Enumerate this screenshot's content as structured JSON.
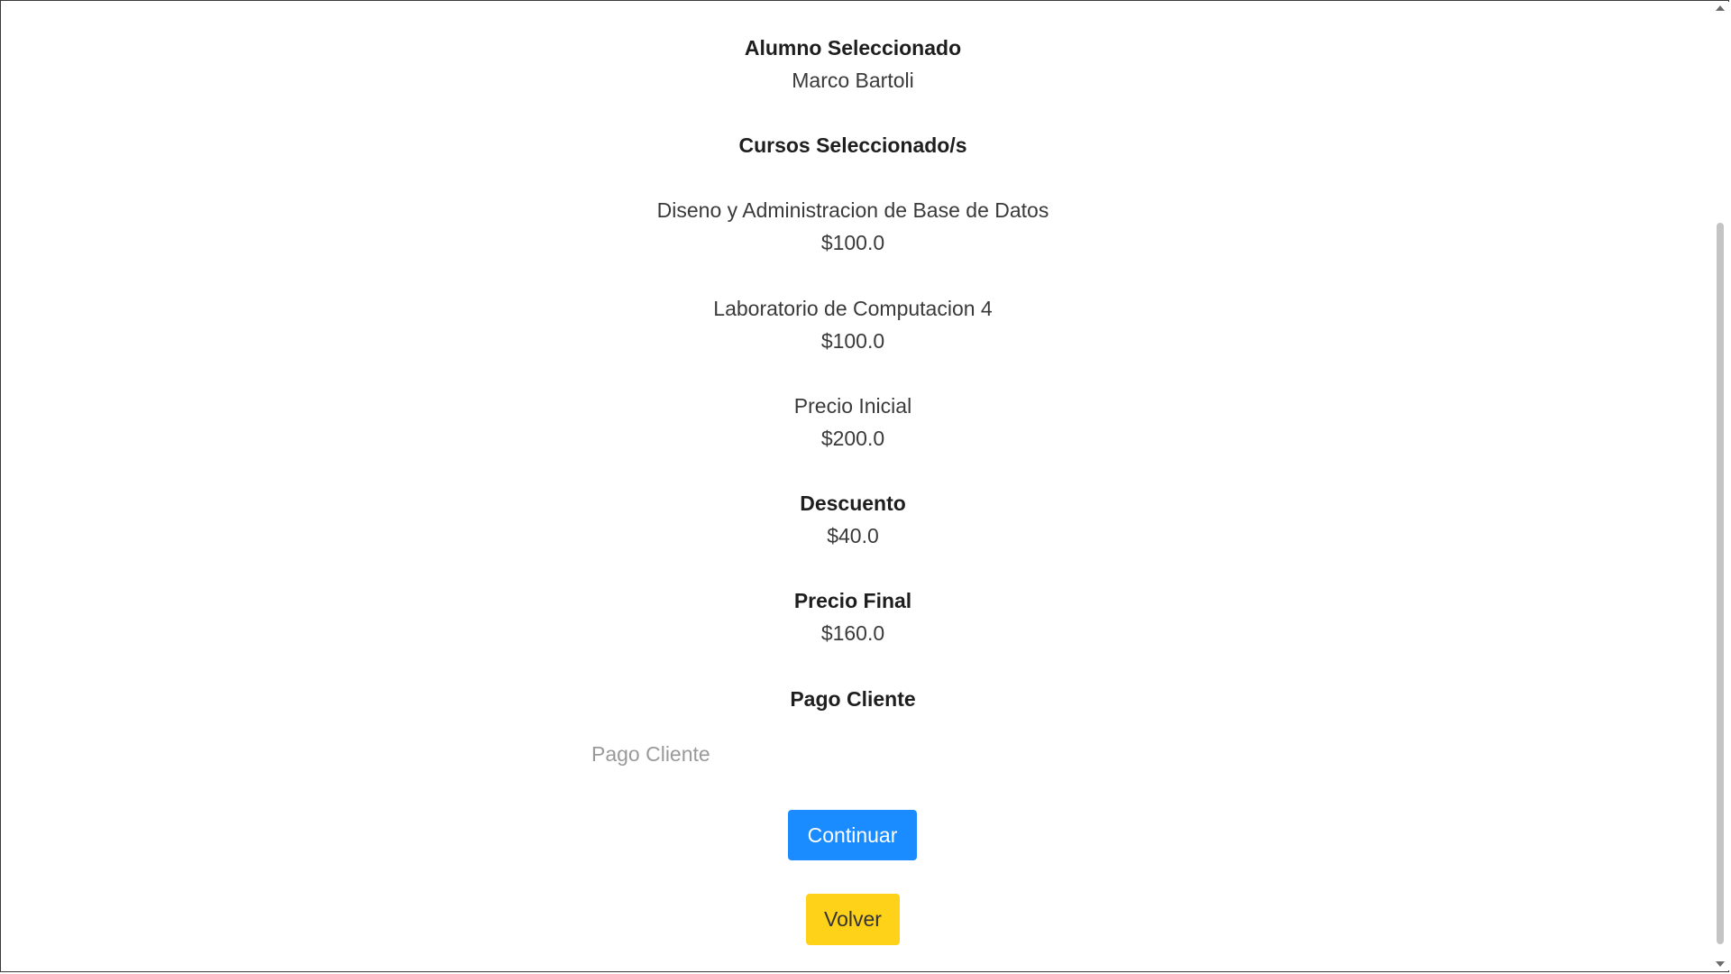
{
  "alumno": {
    "heading": "Alumno Seleccionado",
    "name": "Marco Bartoli"
  },
  "cursos": {
    "heading": "Cursos Seleccionado/s",
    "items": [
      {
        "name": "Diseno y Administracion de Base de Datos",
        "price": "$100.0"
      },
      {
        "name": "Laboratorio de Computacion 4",
        "price": "$100.0"
      }
    ]
  },
  "precio_inicial": {
    "label": "Precio Inicial",
    "value": "$200.0"
  },
  "descuento": {
    "label": "Descuento",
    "value": "$40.0"
  },
  "precio_final": {
    "label": "Precio Final",
    "value": "$160.0"
  },
  "pago_cliente": {
    "heading": "Pago Cliente",
    "placeholder": "Pago Cliente",
    "value": ""
  },
  "buttons": {
    "continuar": "Continuar",
    "volver": "Volver"
  },
  "colors": {
    "primary": "#1a8cff",
    "warning": "#ffd21a"
  }
}
